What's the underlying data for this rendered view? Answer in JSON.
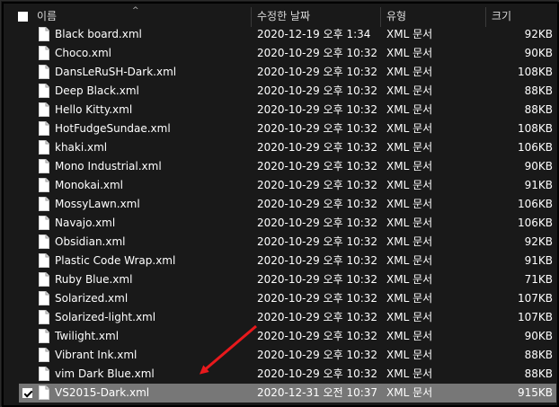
{
  "header": {
    "name_label": "이름",
    "date_label": "수정한 날짜",
    "type_label": "유형",
    "size_label": "크기",
    "sort_indicator": "^"
  },
  "files": [
    {
      "name": "Black board.xml",
      "date": "2020-12-19 오후 1:34",
      "type": "XML 문서",
      "size": "92KB"
    },
    {
      "name": "Choco.xml",
      "date": "2020-10-29 오후 10:32",
      "type": "XML 문서",
      "size": "90KB"
    },
    {
      "name": "DansLeRuSH-Dark.xml",
      "date": "2020-10-29 오후 10:32",
      "type": "XML 문서",
      "size": "108KB"
    },
    {
      "name": "Deep Black.xml",
      "date": "2020-10-29 오후 10:32",
      "type": "XML 문서",
      "size": "88KB"
    },
    {
      "name": "Hello Kitty.xml",
      "date": "2020-10-29 오후 10:32",
      "type": "XML 문서",
      "size": "88KB"
    },
    {
      "name": "HotFudgeSundae.xml",
      "date": "2020-10-29 오후 10:32",
      "type": "XML 문서",
      "size": "108KB"
    },
    {
      "name": "khaki.xml",
      "date": "2020-10-29 오후 10:32",
      "type": "XML 문서",
      "size": "106KB"
    },
    {
      "name": "Mono Industrial.xml",
      "date": "2020-10-29 오후 10:32",
      "type": "XML 문서",
      "size": "90KB"
    },
    {
      "name": "Monokai.xml",
      "date": "2020-10-29 오후 10:32",
      "type": "XML 문서",
      "size": "91KB"
    },
    {
      "name": "MossyLawn.xml",
      "date": "2020-10-29 오후 10:32",
      "type": "XML 문서",
      "size": "106KB"
    },
    {
      "name": "Navajo.xml",
      "date": "2020-10-29 오후 10:32",
      "type": "XML 문서",
      "size": "106KB"
    },
    {
      "name": "Obsidian.xml",
      "date": "2020-10-29 오후 10:32",
      "type": "XML 문서",
      "size": "92KB"
    },
    {
      "name": "Plastic Code Wrap.xml",
      "date": "2020-10-29 오후 10:32",
      "type": "XML 문서",
      "size": "91KB"
    },
    {
      "name": "Ruby Blue.xml",
      "date": "2020-10-29 오후 10:32",
      "type": "XML 문서",
      "size": "71KB"
    },
    {
      "name": "Solarized.xml",
      "date": "2020-10-29 오후 10:32",
      "type": "XML 문서",
      "size": "107KB"
    },
    {
      "name": "Solarized-light.xml",
      "date": "2020-10-29 오후 10:32",
      "type": "XML 문서",
      "size": "107KB"
    },
    {
      "name": "Twilight.xml",
      "date": "2020-10-29 오후 10:32",
      "type": "XML 문서",
      "size": "90KB"
    },
    {
      "name": "Vibrant Ink.xml",
      "date": "2020-10-29 오후 10:32",
      "type": "XML 문서",
      "size": "88KB"
    },
    {
      "name": "vim Dark Blue.xml",
      "date": "2020-10-29 오후 10:32",
      "type": "XML 문서",
      "size": "88KB"
    },
    {
      "name": "VS2015-Dark.xml",
      "date": "2020-12-31 오전 10:37",
      "type": "XML 문서",
      "size": "915KB",
      "selected": true
    }
  ],
  "colors": {
    "background": "#191919",
    "selection": "#777777",
    "annotation_arrow": "#e8191c"
  },
  "icons": {
    "file": "document-icon",
    "header_checkbox": "checkbox-icon",
    "row_checkbox": "checkbox-checked-icon",
    "annotation": "red-arrow-annotation"
  }
}
